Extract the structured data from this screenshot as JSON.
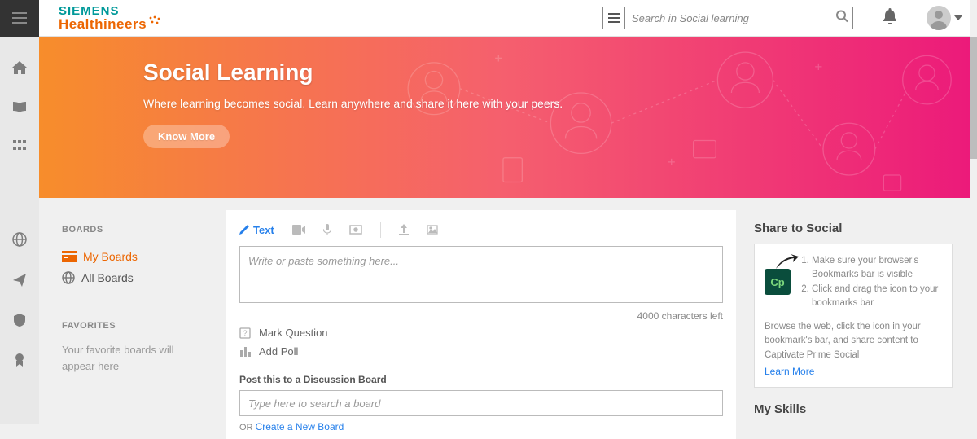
{
  "brand": {
    "top": "SIEMENS",
    "bottom": "Healthineers"
  },
  "search": {
    "placeholder": "Search in Social learning"
  },
  "hero": {
    "title": "Social Learning",
    "subtitle": "Where learning becomes social. Learn anywhere and share it here with your peers.",
    "cta": "Know More"
  },
  "sidebar": {
    "boards_heading": "BOARDS",
    "my_boards": "My Boards",
    "all_boards": "All Boards",
    "favorites_heading": "FAVORITES",
    "favorites_empty": "Your favorite boards will appear here"
  },
  "composer": {
    "text_tab": "Text",
    "placeholder": "Write or paste something here...",
    "chars_left": "4000 characters left",
    "mark_question": "Mark Question",
    "add_poll": "Add Poll",
    "post_label": "Post this to a Discussion Board",
    "board_placeholder": "Type here to search a board",
    "or": "OR ",
    "create_board": "Create a New Board"
  },
  "share": {
    "heading": "Share to Social",
    "step1": "Make sure your browser's Bookmarks bar is visible",
    "step2": "Click and drag the icon to your bookmarks bar",
    "desc": "Browse the web, click the icon in your bookmark's bar, and share content to Captivate Prime Social",
    "learn_more": "Learn More",
    "cp": "Cp"
  },
  "skills": {
    "heading": "My Skills"
  }
}
